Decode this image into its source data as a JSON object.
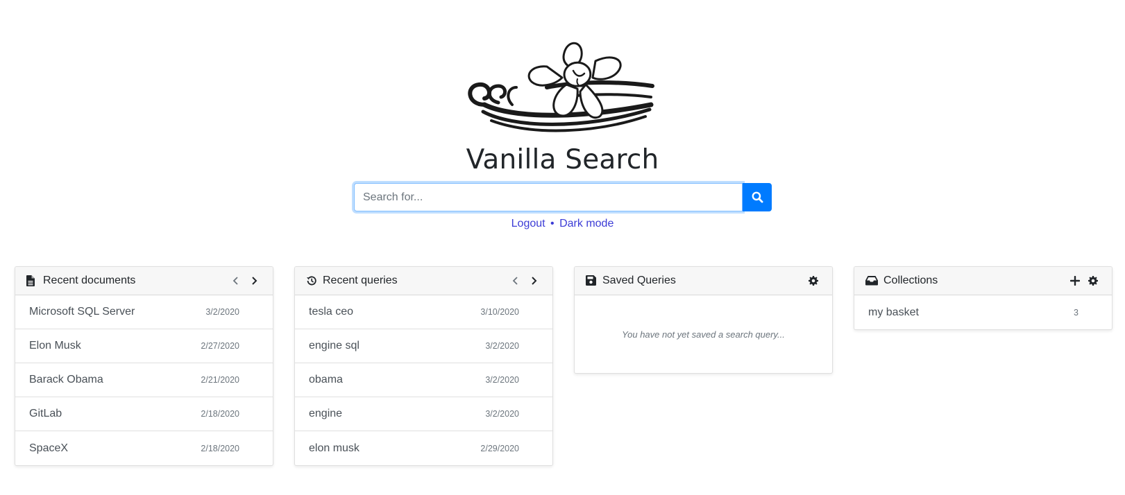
{
  "app": {
    "title": "Vanilla Search"
  },
  "search": {
    "placeholder": "Search for...",
    "value": "",
    "button_icon": "search-icon"
  },
  "links": {
    "logout": "Logout",
    "separator": "•",
    "dark_mode": "Dark mode"
  },
  "colors": {
    "primary": "#007bff",
    "link": "#3c3cd6",
    "card_header_bg": "#f7f7f7"
  },
  "recent_documents": {
    "title": "Recent documents",
    "icon": "file-icon",
    "items": [
      {
        "name": "Microsoft SQL Server",
        "date": "3/2/2020"
      },
      {
        "name": "Elon Musk",
        "date": "2/27/2020"
      },
      {
        "name": "Barack Obama",
        "date": "2/21/2020"
      },
      {
        "name": "GitLab",
        "date": "2/18/2020"
      },
      {
        "name": "SpaceX",
        "date": "2/18/2020"
      }
    ]
  },
  "recent_queries": {
    "title": "Recent queries",
    "icon": "history-icon",
    "items": [
      {
        "name": "tesla ceo",
        "date": "3/10/2020"
      },
      {
        "name": "engine sql",
        "date": "3/2/2020"
      },
      {
        "name": "obama",
        "date": "3/2/2020"
      },
      {
        "name": "engine",
        "date": "3/2/2020"
      },
      {
        "name": "elon musk",
        "date": "2/29/2020"
      }
    ]
  },
  "saved_queries": {
    "title": "Saved Queries",
    "icon": "save-icon",
    "empty_message": "You have not yet saved a search query..."
  },
  "collections": {
    "title": "Collections",
    "icon": "inbox-icon",
    "items": [
      {
        "name": "my basket",
        "count": "3"
      }
    ]
  }
}
